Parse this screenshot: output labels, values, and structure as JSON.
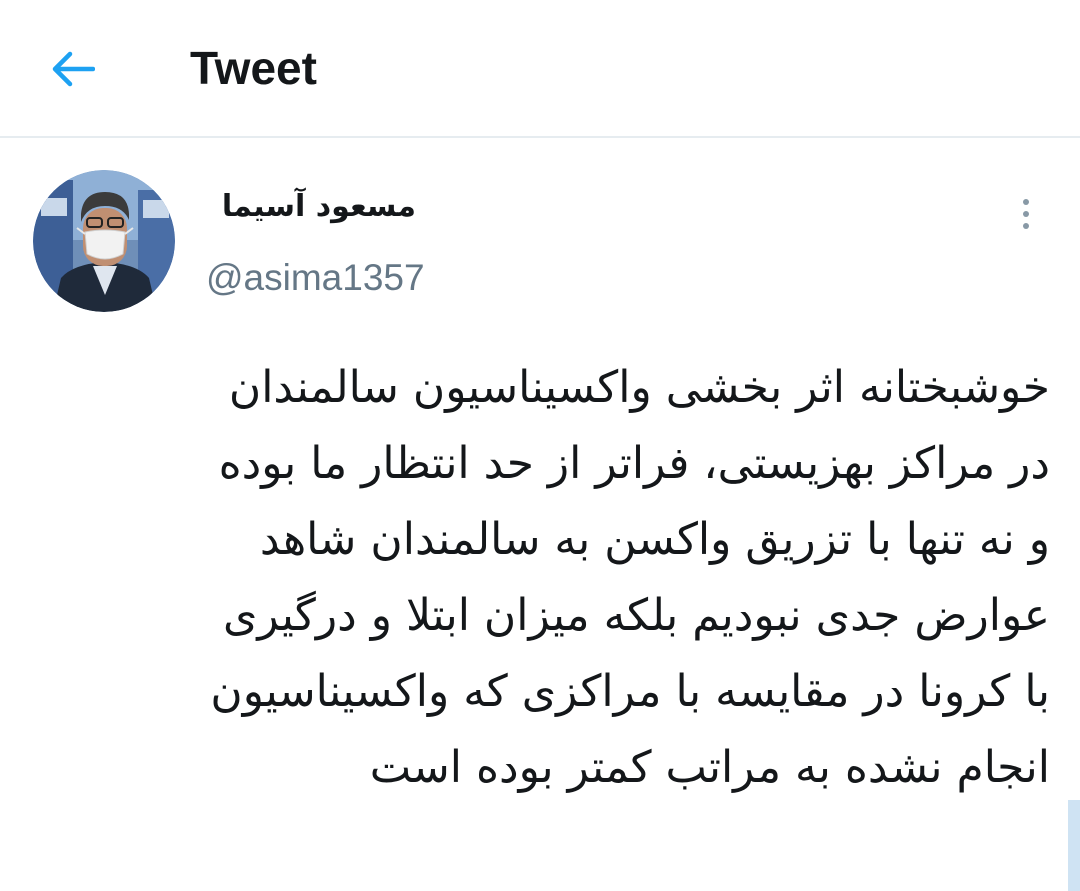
{
  "colors": {
    "accent": "#1da1f2",
    "text_primary": "#14171a",
    "text_secondary": "#657786",
    "divider": "#e6ecf0"
  },
  "header": {
    "back_icon": "arrow-left-icon",
    "title": "Tweet"
  },
  "tweet": {
    "author": {
      "display_name": "مسعود آسیما",
      "handle": "@asima1357",
      "avatar": "profile-photo-man-with-face-mask"
    },
    "more_icon": "more-vertical-icon",
    "lines": [
      "خوشبختانه اثر بخشی واکسیناسیون سالمندان",
      "در مراکز بهزیستی، فراتر از حد انتظار ما بوده",
      "و نه تنها با تزریق واکسن به سالمندان شاهد",
      "عوارض جدی نبودیم بلکه میزان ابتلا و درگیری",
      "با کرونا در مقایسه با مراکزی که واکسیناسیون",
      "انجام نشده به مراتب کمتر بوده است"
    ]
  }
}
